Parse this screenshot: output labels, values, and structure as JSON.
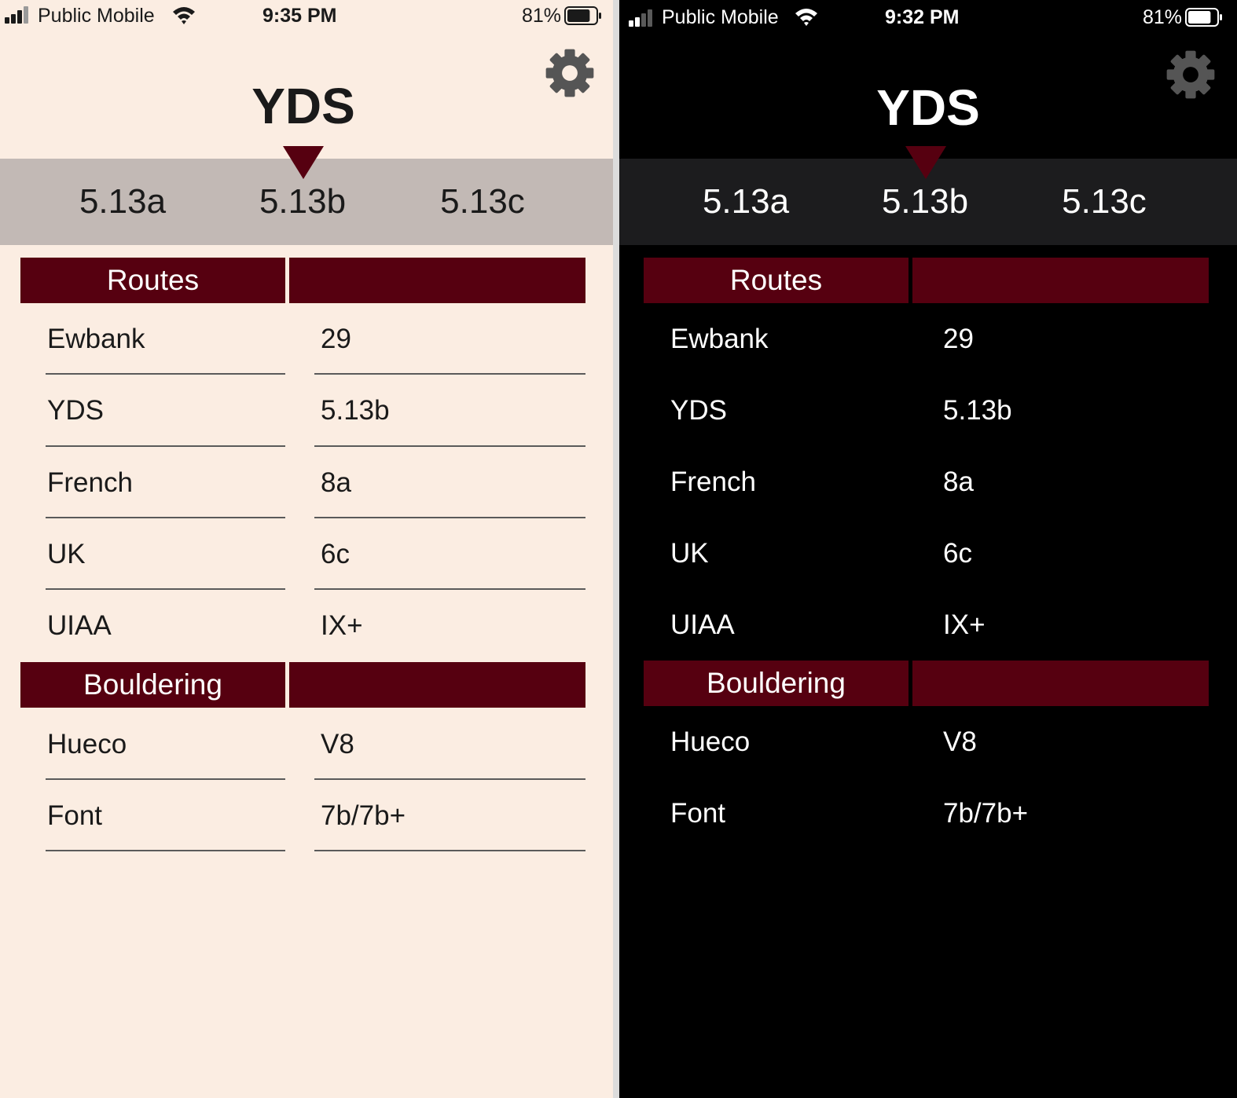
{
  "status_light": {
    "carrier": "Public Mobile",
    "time": "9:35 PM",
    "battery": "81%",
    "battery_level": 0.81
  },
  "status_dark": {
    "carrier": "Public Mobile",
    "time": "9:32 PM",
    "battery": "81%",
    "battery_level": 0.81
  },
  "header": {
    "title": "YDS",
    "settings_icon": "gear-icon"
  },
  "picker": {
    "grades": [
      "5.13a",
      "5.13b",
      "5.13c"
    ],
    "selected": "5.13b"
  },
  "sections": {
    "routes": {
      "title": "Routes",
      "rows": [
        {
          "label": "Ewbank",
          "value": "29"
        },
        {
          "label": "YDS",
          "value": "5.13b"
        },
        {
          "label": "French",
          "value": "8a"
        },
        {
          "label": "UK",
          "value": "6c"
        },
        {
          "label": "UIAA",
          "value": "IX+"
        }
      ]
    },
    "bouldering": {
      "title": "Bouldering",
      "rows": [
        {
          "label": "Hueco",
          "value": "V8"
        },
        {
          "label": "Font",
          "value": "7b/7b+"
        }
      ]
    }
  },
  "colors": {
    "light_background": "#fbede2",
    "light_picker": "#c2b9b5",
    "dark_background": "#000000",
    "dark_picker": "#1c1c1e",
    "accent": "#560010",
    "gear": "#555555"
  }
}
